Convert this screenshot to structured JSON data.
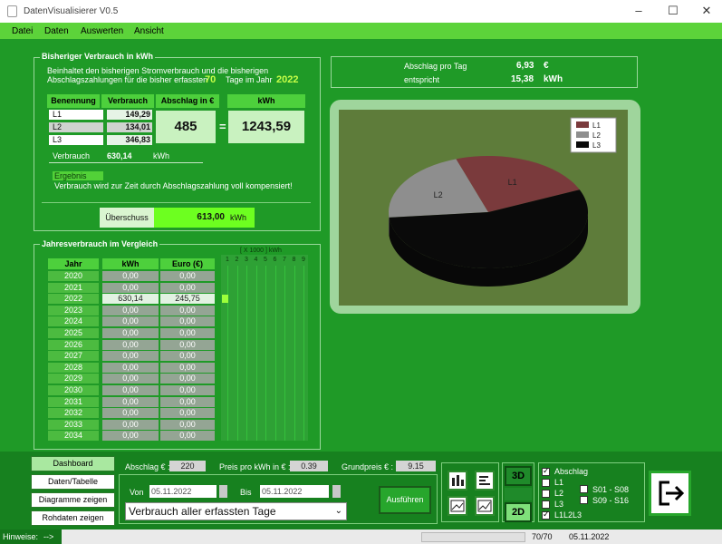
{
  "window": {
    "title": "DatenVisualisierer V0.5",
    "minimize": "–",
    "maximize": "☐",
    "close": "✕"
  },
  "menu": [
    "Datei",
    "Daten",
    "Auswerten",
    "Ansicht"
  ],
  "consumption": {
    "title": "Bisheriger Verbrauch in kWh",
    "desc_line1": "Beinhaltet den bisherigen Stromverbrauch und die bisherigen",
    "desc_line2": "Abschlagszahlungen für die bisher erfassten",
    "days": "70",
    "days_label": "Tage im Jahr",
    "year": "2022",
    "headers": {
      "name": "Benennung",
      "usage": "Verbrauch",
      "deduction": "Abschlag in €",
      "kwh": "kWh"
    },
    "rows": [
      {
        "name": "L1",
        "value": "149,29"
      },
      {
        "name": "L2",
        "value": "134,01"
      },
      {
        "name": "L3",
        "value": "346,83"
      }
    ],
    "abschlag_total": "485",
    "equals": "=",
    "kwh_total": "1243,59",
    "verbrauch_label": "Verbrauch",
    "verbrauch_value": "630,14",
    "verbrauch_unit": "kWh",
    "ergebnis_label": "Ergebnis",
    "ergebnis_text": "Verbrauch wird zur Zeit durch Abschlagszahlung voll kompensiert!",
    "surplus_label": "Überschuss",
    "surplus_value": "613,00",
    "surplus_unit": "kWh"
  },
  "daily": {
    "label1": "Abschlag pro Tag",
    "value1": "6,93",
    "unit1": "€",
    "label2": "entspricht",
    "value2": "15,38",
    "unit2": "kWh"
  },
  "yearly": {
    "title": "Jahresverbrauch im Vergleich",
    "headers": {
      "year": "Jahr",
      "kwh": "kWh",
      "euro": "Euro (€)"
    },
    "rows": [
      {
        "year": "2020",
        "kwh": "0,00",
        "euro": "0,00"
      },
      {
        "year": "2021",
        "kwh": "0,00",
        "euro": "0,00"
      },
      {
        "year": "2022",
        "kwh": "630,14",
        "euro": "245,75"
      },
      {
        "year": "2023",
        "kwh": "0,00",
        "euro": "0,00"
      },
      {
        "year": "2024",
        "kwh": "0,00",
        "euro": "0,00"
      },
      {
        "year": "2025",
        "kwh": "0,00",
        "euro": "0,00"
      },
      {
        "year": "2026",
        "kwh": "0,00",
        "euro": "0,00"
      },
      {
        "year": "2027",
        "kwh": "0,00",
        "euro": "0,00"
      },
      {
        "year": "2028",
        "kwh": "0,00",
        "euro": "0,00"
      },
      {
        "year": "2029",
        "kwh": "0,00",
        "euro": "0,00"
      },
      {
        "year": "2030",
        "kwh": "0,00",
        "euro": "0,00"
      },
      {
        "year": "2031",
        "kwh": "0,00",
        "euro": "0,00"
      },
      {
        "year": "2032",
        "kwh": "0,00",
        "euro": "0,00"
      },
      {
        "year": "2033",
        "kwh": "0,00",
        "euro": "0,00"
      },
      {
        "year": "2034",
        "kwh": "0,00",
        "euro": "0,00"
      }
    ],
    "scale_label": "[ X 1000 ]  kWh",
    "scale_ticks": [
      "1",
      "2",
      "3",
      "4",
      "5",
      "6",
      "7",
      "8",
      "9"
    ],
    "bar_levels": [
      0,
      0,
      0.07,
      0,
      0,
      0,
      0,
      0,
      0,
      0,
      0,
      0,
      0,
      0,
      0
    ]
  },
  "colors": {
    "l1": "#7a3a3c",
    "l2": "#8e8e8e",
    "l3": "#0a0a0a",
    "plot_bg": "#5e7c3a",
    "frame": "#9fd59c"
  },
  "chart_data": {
    "type": "pie",
    "categories": [
      "L1",
      "L2",
      "L3"
    ],
    "values": [
      149.29,
      134.01,
      346.83
    ],
    "legend": [
      "L1",
      "L2",
      "L3"
    ],
    "legend_position": "top-right",
    "slice_labels": [
      "L1",
      "L2"
    ]
  },
  "nav": {
    "dashboard": "Dashboard",
    "data_table": "Daten/Tabelle",
    "charts": "Diagramme zeigen",
    "raw": "Rohdaten zeigen"
  },
  "params": {
    "abschlag_label": "Abschlag € :",
    "abschlag_value": "220",
    "price_label": "Preis pro kWh in € :",
    "price_value": "0.39",
    "grundpreis_label": "Grundpreis € :",
    "grundpreis_value": "9.15"
  },
  "range": {
    "from_label": "Von",
    "from_date": "05.11.2022",
    "to_label": "Bis",
    "to_date": "05.11.2022",
    "select_value": "Verbrauch aller erfassten Tage",
    "run_label": "Ausführen"
  },
  "view": {
    "btn_3d": "3D",
    "btn_2d": "2D"
  },
  "options": {
    "abschlag": "Abschlag",
    "l1": "L1",
    "l2": "L2",
    "l3": "L3",
    "l1l2l3": "L1L2L3",
    "s1": "S01 - S08",
    "s2": "S09 - S16"
  },
  "status": {
    "hint_label": "Hinweise:",
    "hint_value": "-->",
    "counter": "70/70",
    "date": "05.11.2022"
  }
}
